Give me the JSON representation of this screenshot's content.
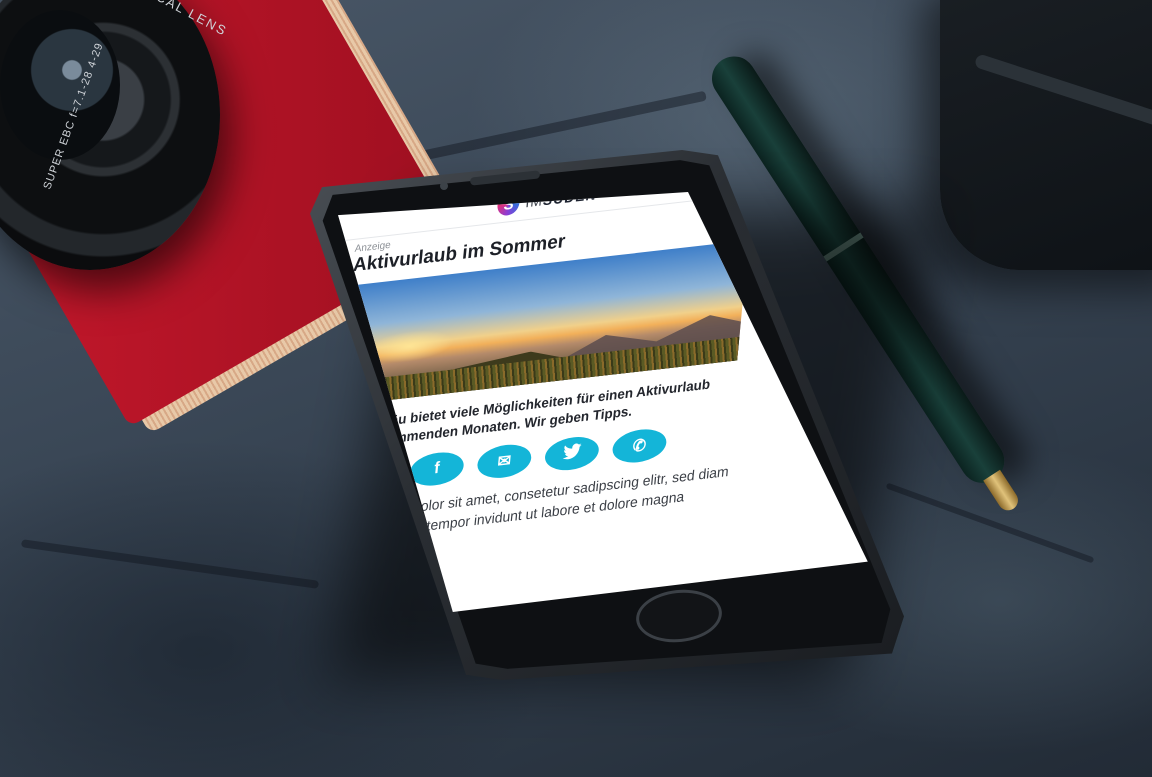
{
  "logo": {
    "prefix": "IM",
    "name": "SÜDEN",
    "mark": "S"
  },
  "lens_text": {
    "top": "FUJINON ASPHERICAL LENS",
    "side": "SUPER EBC f=7.1-28 4-29"
  },
  "article": {
    "ad_label": "Anzeige",
    "headline": "Aktivurlaub im Sommer",
    "teaser": "Das Allgäu bietet viele Möglichkeiten für einen Aktivurlaub in den kommenden Monaten. Wir geben Tipps.",
    "body": "Lorem ipsum dolor sit amet, consetetur sadipscing elitr, sed diam nonumy eirmod tempor invidunt ut labore et dolore magna"
  },
  "share": [
    {
      "icon": "facebook-icon"
    },
    {
      "icon": "email-icon"
    },
    {
      "icon": "twitter-icon"
    },
    {
      "icon": "whatsapp-icon"
    }
  ],
  "colors": {
    "accent": "#14b5d8",
    "notebook": "#c9192d",
    "pen": "#19403a"
  }
}
